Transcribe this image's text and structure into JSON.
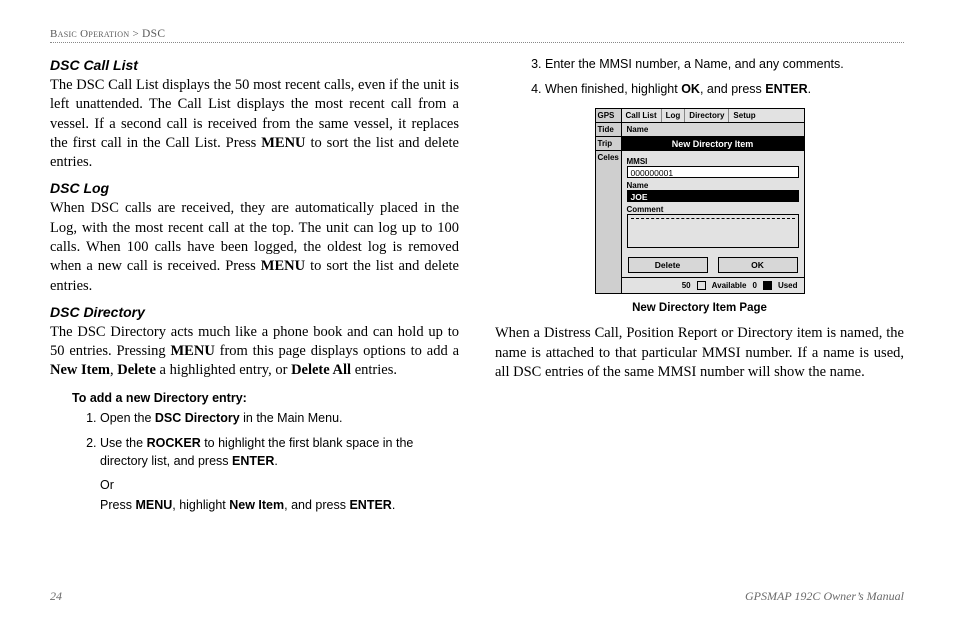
{
  "breadcrumb": {
    "part1": "Basic Operation",
    "sep": " > ",
    "part2": "DSC"
  },
  "left": {
    "h1": "DSC Call List",
    "p1_a": "The DSC Call List displays the 50 most recent calls, even if the unit is left unattended. The Call List displays the most recent call from a vessel. If a second call is received from the same vessel, it replaces the first call in the Call List. Press ",
    "p1_b": "MENU",
    "p1_c": " to sort the list and delete entries.",
    "h2": "DSC Log",
    "p2_a": "When DSC calls are received, they are automatically placed in the Log, with the most recent call at the top. The unit can log up to 100 calls. When 100 calls have been logged, the oldest log is removed when a new call is received. Press ",
    "p2_b": "MENU",
    "p2_c": " to sort the list and delete entries.",
    "h3": "DSC Directory",
    "p3_a": "The DSC Directory acts much like a phone book and can hold up to 50 entries. Pressing ",
    "p3_b": "MENU",
    "p3_c": " from this page displays options to add a ",
    "p3_d": "New Item",
    "p3_e": ", ",
    "p3_f": "Delete",
    "p3_g": " a highlighted entry, or ",
    "p3_h": "Delete All",
    "p3_i": " entries.",
    "subhead": "To add a new Directory entry:",
    "s1_a": "Open the ",
    "s1_b": "DSC Directory",
    "s1_c": " in the Main Menu.",
    "s2_a": "Use the ",
    "s2_b": "ROCKER",
    "s2_c": " to highlight the first blank space in the directory list, and press ",
    "s2_d": "ENTER",
    "s2_e": ".",
    "s2_or": "Or",
    "s2_f": "Press ",
    "s2_g": "MENU",
    "s2_h": ", highlight ",
    "s2_i": "New Item",
    "s2_j": ", and press ",
    "s2_k": "ENTER",
    "s2_l": "."
  },
  "right": {
    "s3": "Enter the MMSI number, a Name, and any comments.",
    "s4_a": "When finished, highlight ",
    "s4_b": "OK",
    "s4_c": ", and press ",
    "s4_d": "ENTER",
    "s4_e": ".",
    "caption": "New Directory Item Page",
    "p_a": "When a Distress Call, Position Report or Directory item is named, the name is attached to that particular MMSI number. If a name is used, all DSC entries of the same MMSI number will show the name."
  },
  "fig": {
    "side": [
      "GPS",
      "Tide",
      "Trip",
      "Celes"
    ],
    "tabs": [
      "Call List",
      "Log",
      "Directory",
      "Setup"
    ],
    "subtabs": [
      "Name"
    ],
    "title": "New Directory Item",
    "mmsi_label": "MMSI",
    "mmsi_value": "000000001",
    "name_label": "Name",
    "name_value": "JOE",
    "comment_label": "Comment",
    "btn_delete": "Delete",
    "btn_ok": "OK",
    "status_count": "50",
    "status_avail": "Available",
    "status_ucount": "0",
    "status_used": "Used"
  },
  "footer": {
    "page": "24",
    "doc": "GPSMAP 192C Owner’s Manual"
  }
}
